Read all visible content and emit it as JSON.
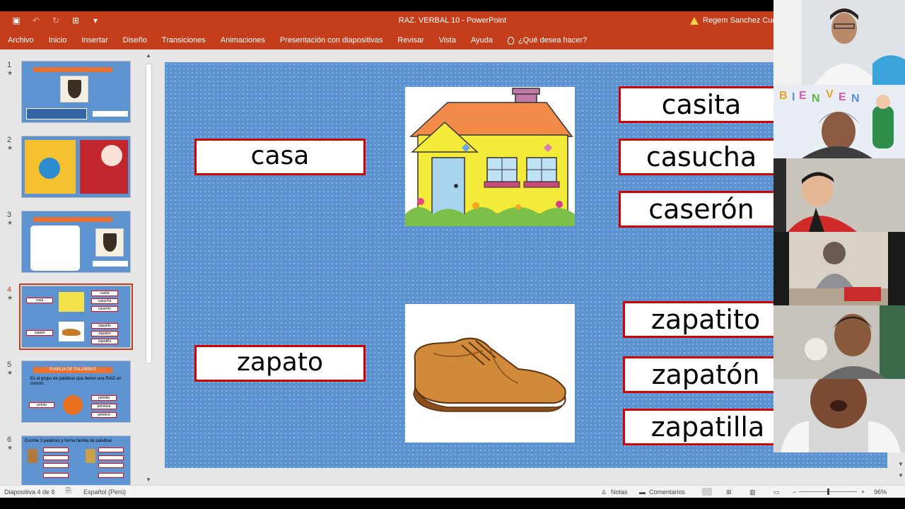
{
  "window": {
    "title": "RAZ. VERBAL 10  -  PowerPoint",
    "user": "Regem Sanchez Curo"
  },
  "menu": {
    "items": [
      "Archivo",
      "Inicio",
      "Insertar",
      "Diseño",
      "Transiciones",
      "Animaciones",
      "Presentación con diapositivas",
      "Revisar",
      "Vista",
      "Ayuda"
    ],
    "tell_me": "¿Qué desea hacer?"
  },
  "thumbnails": [
    {
      "num": "1",
      "star": "★",
      "title": "RAZONAMIENTO VERBAL - CLASE 10"
    },
    {
      "num": "2",
      "star": "★",
      "left": "YO ME QUEDO EN CASA",
      "right": "NO PUEDES HERMANITO DE CORONAVIRUS"
    },
    {
      "num": "3",
      "star": "★",
      "title": "RAZONAMIENTO VERBAL - CLASE 10"
    },
    {
      "num": "4",
      "star": "★",
      "words": [
        "casa",
        "casita",
        "casucha",
        "caserón",
        "zapato",
        "zapatito",
        "zapatón",
        "zapatilla"
      ]
    },
    {
      "num": "5",
      "star": "★",
      "title": "FAMILIA DE PALABRAS",
      "text": "Es el grupo de palabras que tienen una RAIZ en común.",
      "words": [
        "pelota",
        "pelotita",
        "pelotaza",
        "pelotero"
      ]
    },
    {
      "num": "6",
      "star": "★",
      "title": "Escribe 3 palabras y forma familia de palabras"
    }
  ],
  "slide": {
    "word_casa": "casa",
    "casa_family": [
      "casita",
      "casucha",
      "caserón"
    ],
    "word_zapato": "zapato",
    "zapato_family": [
      "zapatito",
      "zapatón",
      "zapatilla"
    ]
  },
  "status": {
    "slide_of": "Diapositiva 4 de 8",
    "language": "Español (Perú)",
    "notes": "Notas",
    "comments": "Comentarios",
    "zoom": "96%"
  },
  "colors": {
    "ribbon": "#c43e1c",
    "slide_bg": "#5b93d1",
    "box_border": "#d40000"
  }
}
